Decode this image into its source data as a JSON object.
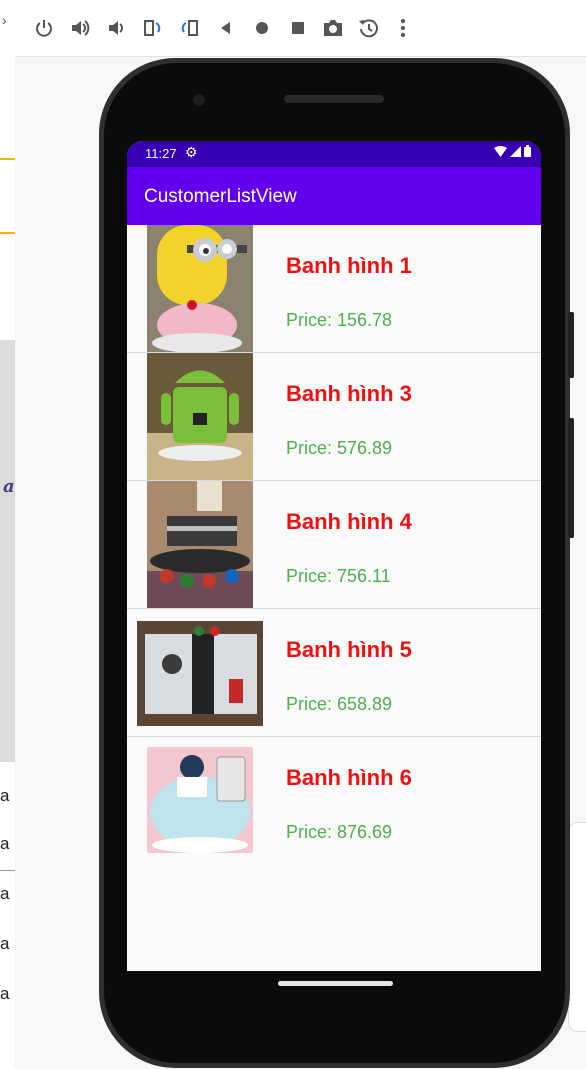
{
  "left_panel": {
    "letters": [
      "a",
      "a",
      "a",
      "a",
      "a",
      "a"
    ]
  },
  "toolbar": {
    "icons": [
      "power-icon",
      "volume-up-icon",
      "volume-down-icon",
      "rotate-left-icon",
      "rotate-right-icon",
      "back-icon",
      "home-icon",
      "overview-icon",
      "camera-icon",
      "replay-icon",
      "more-icon"
    ]
  },
  "status_bar": {
    "time": "11:27"
  },
  "app": {
    "title": "CustomerListView"
  },
  "items": [
    {
      "name": "Banh hình 1",
      "price": "Price: 156.78"
    },
    {
      "name": "Banh hình 3",
      "price": "Price: 576.89"
    },
    {
      "name": "Banh hình 4",
      "price": "Price: 756.11"
    },
    {
      "name": "Banh hình 5",
      "price": "Price: 658.89"
    },
    {
      "name": "Banh hình 6",
      "price": "Price: 876.69"
    }
  ],
  "colors": {
    "status_bar": "#3700b3",
    "app_bar": "#6200ee",
    "item_name": "#ee1111",
    "item_price": "#4caf50"
  }
}
